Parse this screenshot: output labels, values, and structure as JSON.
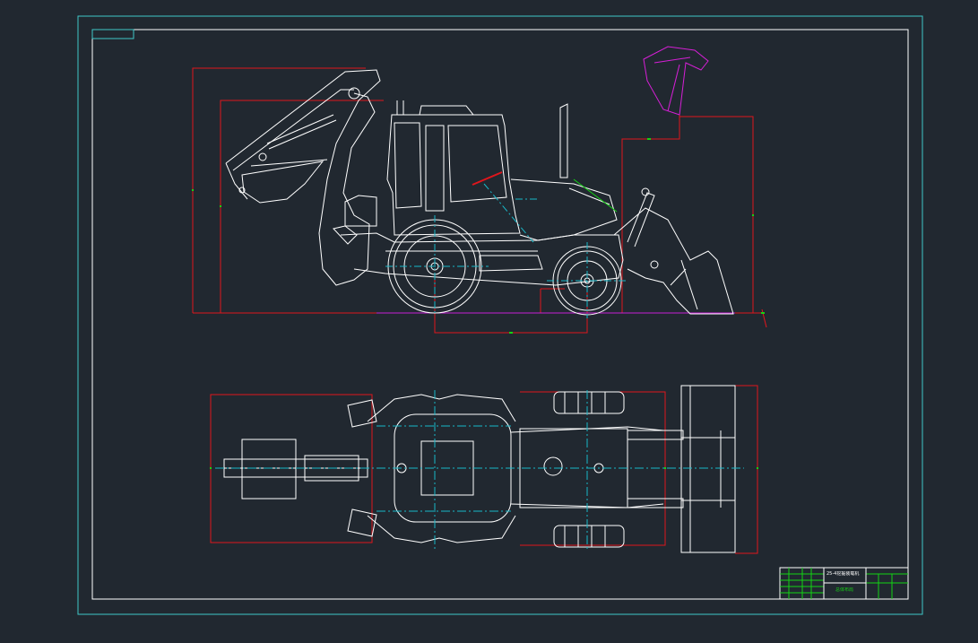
{
  "drawing": {
    "background_color": "#212830",
    "outer_frame_color": "#3ec7c7",
    "inner_frame_color": "#ffffff",
    "linework_color": "#ffffff",
    "dimension_color": "#e0161c",
    "centerline_color": "#18b9c9",
    "dim_text_color": "#14d314",
    "bucket_highlight_color": "#d61fd6",
    "ground_line_color": "#c81fd6"
  },
  "title_block": {
    "title": "25-4挖掘装载机",
    "subtitle": "总体布局"
  },
  "views": {
    "side_view": "backhoe-loader-elevation",
    "top_view": "backhoe-loader-plan"
  }
}
